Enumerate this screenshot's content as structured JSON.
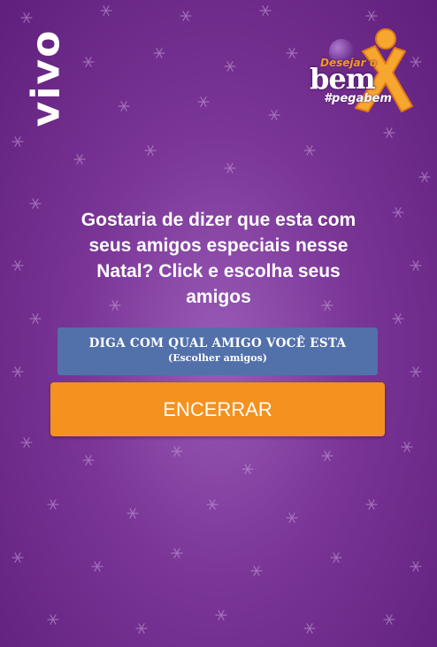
{
  "brand": {
    "logo_text": "vivo"
  },
  "campaign": {
    "small_text": "Desejar o",
    "big_text": "bem",
    "hashtag": "#pegabem"
  },
  "message": "Gostaria de dizer que esta com seus amigos especiais nesse Natal? Click e escolha seus amigos",
  "choose_button": {
    "line1": "DIGA COM QUAL AMIGO VOCÊ ESTA",
    "line2": "(Escolher amigos)"
  },
  "end_button": {
    "label": "ENCERRAR"
  },
  "colors": {
    "background": "#7a3596",
    "choose_button": "#5270aa",
    "end_button": "#f5911e",
    "accent_orange": "#f29a1f"
  }
}
